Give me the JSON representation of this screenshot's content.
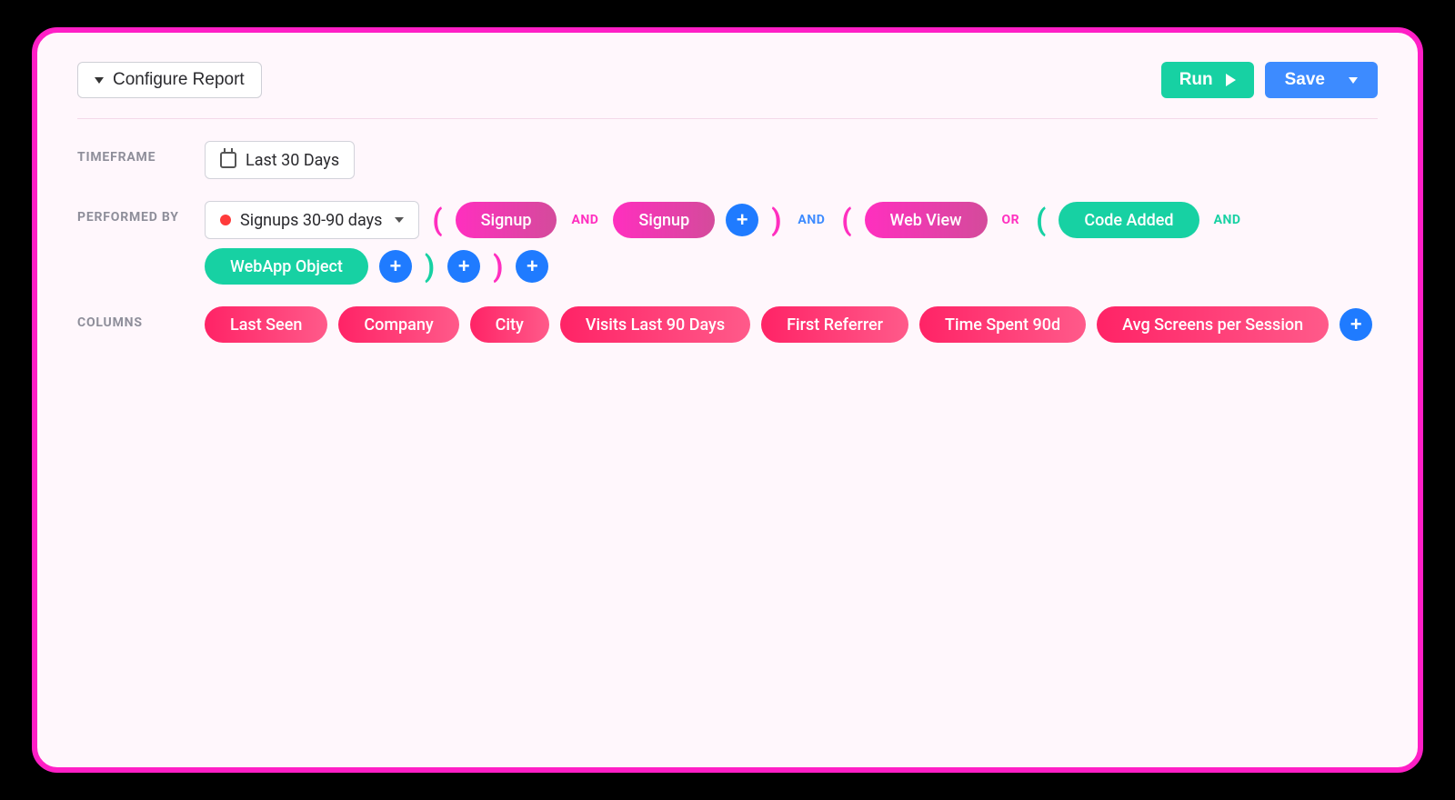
{
  "toolbar": {
    "configure_label": "Configure Report",
    "run_label": "Run",
    "save_label": "Save"
  },
  "sections": {
    "timeframe_label": "TIMEFRAME",
    "performed_by_label": "PERFORMED BY",
    "columns_label": "COLUMNS"
  },
  "timeframe": {
    "value": "Last 30 Days"
  },
  "performed_by": {
    "segment": "Signups 30-90 days",
    "logic": {
      "and": "AND",
      "or": "OR"
    },
    "events": {
      "e1": "Signup",
      "e2": "Signup",
      "e3": "Web View",
      "e4": "Code Added",
      "e5": "WebApp Object"
    }
  },
  "columns": {
    "items": [
      "Last Seen",
      "Company",
      "City",
      "Visits Last 90 Days",
      "First Referrer",
      "Time Spent 90d",
      "Avg Screens per Session"
    ]
  },
  "icons": {
    "plus": "+"
  }
}
